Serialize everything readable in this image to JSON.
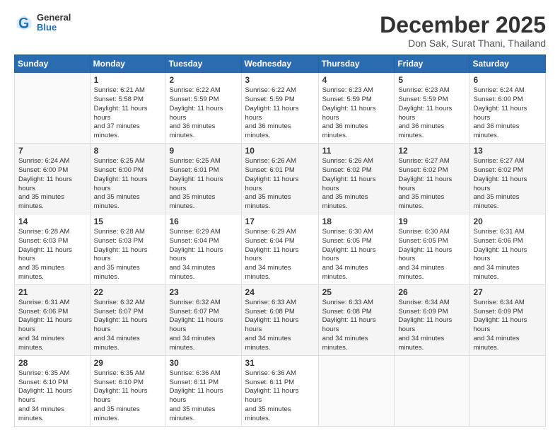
{
  "header": {
    "logo": {
      "general": "General",
      "blue": "Blue"
    },
    "title": "December 2025",
    "location": "Don Sak, Surat Thani, Thailand"
  },
  "days_of_week": [
    "Sunday",
    "Monday",
    "Tuesday",
    "Wednesday",
    "Thursday",
    "Friday",
    "Saturday"
  ],
  "weeks": [
    [
      {
        "num": "",
        "sunrise": "",
        "sunset": "",
        "daylight": ""
      },
      {
        "num": "1",
        "sunrise": "Sunrise: 6:21 AM",
        "sunset": "Sunset: 5:58 PM",
        "daylight": "Daylight: 11 hours and 37 minutes."
      },
      {
        "num": "2",
        "sunrise": "Sunrise: 6:22 AM",
        "sunset": "Sunset: 5:59 PM",
        "daylight": "Daylight: 11 hours and 36 minutes."
      },
      {
        "num": "3",
        "sunrise": "Sunrise: 6:22 AM",
        "sunset": "Sunset: 5:59 PM",
        "daylight": "Daylight: 11 hours and 36 minutes."
      },
      {
        "num": "4",
        "sunrise": "Sunrise: 6:23 AM",
        "sunset": "Sunset: 5:59 PM",
        "daylight": "Daylight: 11 hours and 36 minutes."
      },
      {
        "num": "5",
        "sunrise": "Sunrise: 6:23 AM",
        "sunset": "Sunset: 5:59 PM",
        "daylight": "Daylight: 11 hours and 36 minutes."
      },
      {
        "num": "6",
        "sunrise": "Sunrise: 6:24 AM",
        "sunset": "Sunset: 6:00 PM",
        "daylight": "Daylight: 11 hours and 36 minutes."
      }
    ],
    [
      {
        "num": "7",
        "sunrise": "Sunrise: 6:24 AM",
        "sunset": "Sunset: 6:00 PM",
        "daylight": "Daylight: 11 hours and 35 minutes."
      },
      {
        "num": "8",
        "sunrise": "Sunrise: 6:25 AM",
        "sunset": "Sunset: 6:00 PM",
        "daylight": "Daylight: 11 hours and 35 minutes."
      },
      {
        "num": "9",
        "sunrise": "Sunrise: 6:25 AM",
        "sunset": "Sunset: 6:01 PM",
        "daylight": "Daylight: 11 hours and 35 minutes."
      },
      {
        "num": "10",
        "sunrise": "Sunrise: 6:26 AM",
        "sunset": "Sunset: 6:01 PM",
        "daylight": "Daylight: 11 hours and 35 minutes."
      },
      {
        "num": "11",
        "sunrise": "Sunrise: 6:26 AM",
        "sunset": "Sunset: 6:02 PM",
        "daylight": "Daylight: 11 hours and 35 minutes."
      },
      {
        "num": "12",
        "sunrise": "Sunrise: 6:27 AM",
        "sunset": "Sunset: 6:02 PM",
        "daylight": "Daylight: 11 hours and 35 minutes."
      },
      {
        "num": "13",
        "sunrise": "Sunrise: 6:27 AM",
        "sunset": "Sunset: 6:02 PM",
        "daylight": "Daylight: 11 hours and 35 minutes."
      }
    ],
    [
      {
        "num": "14",
        "sunrise": "Sunrise: 6:28 AM",
        "sunset": "Sunset: 6:03 PM",
        "daylight": "Daylight: 11 hours and 35 minutes."
      },
      {
        "num": "15",
        "sunrise": "Sunrise: 6:28 AM",
        "sunset": "Sunset: 6:03 PM",
        "daylight": "Daylight: 11 hours and 35 minutes."
      },
      {
        "num": "16",
        "sunrise": "Sunrise: 6:29 AM",
        "sunset": "Sunset: 6:04 PM",
        "daylight": "Daylight: 11 hours and 34 minutes."
      },
      {
        "num": "17",
        "sunrise": "Sunrise: 6:29 AM",
        "sunset": "Sunset: 6:04 PM",
        "daylight": "Daylight: 11 hours and 34 minutes."
      },
      {
        "num": "18",
        "sunrise": "Sunrise: 6:30 AM",
        "sunset": "Sunset: 6:05 PM",
        "daylight": "Daylight: 11 hours and 34 minutes."
      },
      {
        "num": "19",
        "sunrise": "Sunrise: 6:30 AM",
        "sunset": "Sunset: 6:05 PM",
        "daylight": "Daylight: 11 hours and 34 minutes."
      },
      {
        "num": "20",
        "sunrise": "Sunrise: 6:31 AM",
        "sunset": "Sunset: 6:06 PM",
        "daylight": "Daylight: 11 hours and 34 minutes."
      }
    ],
    [
      {
        "num": "21",
        "sunrise": "Sunrise: 6:31 AM",
        "sunset": "Sunset: 6:06 PM",
        "daylight": "Daylight: 11 hours and 34 minutes."
      },
      {
        "num": "22",
        "sunrise": "Sunrise: 6:32 AM",
        "sunset": "Sunset: 6:07 PM",
        "daylight": "Daylight: 11 hours and 34 minutes."
      },
      {
        "num": "23",
        "sunrise": "Sunrise: 6:32 AM",
        "sunset": "Sunset: 6:07 PM",
        "daylight": "Daylight: 11 hours and 34 minutes."
      },
      {
        "num": "24",
        "sunrise": "Sunrise: 6:33 AM",
        "sunset": "Sunset: 6:08 PM",
        "daylight": "Daylight: 11 hours and 34 minutes."
      },
      {
        "num": "25",
        "sunrise": "Sunrise: 6:33 AM",
        "sunset": "Sunset: 6:08 PM",
        "daylight": "Daylight: 11 hours and 34 minutes."
      },
      {
        "num": "26",
        "sunrise": "Sunrise: 6:34 AM",
        "sunset": "Sunset: 6:09 PM",
        "daylight": "Daylight: 11 hours and 34 minutes."
      },
      {
        "num": "27",
        "sunrise": "Sunrise: 6:34 AM",
        "sunset": "Sunset: 6:09 PM",
        "daylight": "Daylight: 11 hours and 34 minutes."
      }
    ],
    [
      {
        "num": "28",
        "sunrise": "Sunrise: 6:35 AM",
        "sunset": "Sunset: 6:10 PM",
        "daylight": "Daylight: 11 hours and 34 minutes."
      },
      {
        "num": "29",
        "sunrise": "Sunrise: 6:35 AM",
        "sunset": "Sunset: 6:10 PM",
        "daylight": "Daylight: 11 hours and 35 minutes."
      },
      {
        "num": "30",
        "sunrise": "Sunrise: 6:36 AM",
        "sunset": "Sunset: 6:11 PM",
        "daylight": "Daylight: 11 hours and 35 minutes."
      },
      {
        "num": "31",
        "sunrise": "Sunrise: 6:36 AM",
        "sunset": "Sunset: 6:11 PM",
        "daylight": "Daylight: 11 hours and 35 minutes."
      },
      {
        "num": "",
        "sunrise": "",
        "sunset": "",
        "daylight": ""
      },
      {
        "num": "",
        "sunrise": "",
        "sunset": "",
        "daylight": ""
      },
      {
        "num": "",
        "sunrise": "",
        "sunset": "",
        "daylight": ""
      }
    ]
  ]
}
